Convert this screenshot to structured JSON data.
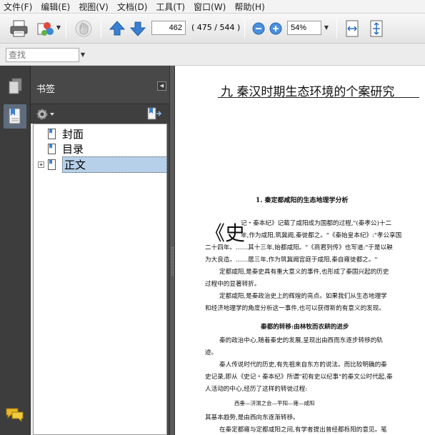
{
  "menu": [
    "文件(F)",
    "编辑(E)",
    "视图(V)",
    "文档(D)",
    "工具(T)",
    "窗口(W)",
    "帮助(H)"
  ],
  "toolbar": {
    "page_current": "462",
    "page_info": "( 475 / 544 )",
    "zoom": "54%"
  },
  "find": {
    "placeholder": "查找"
  },
  "bookmarks": {
    "title": "书签",
    "items": [
      "封面",
      "目录",
      "正文"
    ],
    "expander": "+"
  },
  "document": {
    "chapter_title": "九 秦汉时期生态环境的个案研究",
    "section_heading": "1. 秦定都咸阳的生态地理学分析",
    "dropcap": "《史",
    "lines": [
      "记・秦本纪》记载了咸阳成为国都的过程,\"(秦孝公)十二",
      "年,作为咸阳,筑冀阙,秦徙都之。\"《秦始皇本纪》:\"孝公享国",
      "二十四年。……其十三年,始都咸阳。\"《商君列传》也写道:\"于是以鞅",
      "为大良造。……居三年,作为筑冀阙宫庭于咸阳,秦自雍徙都之。\"",
      "定都咸阳,是秦史具有重大意义的事件,也形成了秦国兴起的历史",
      "过程中的显著转折。",
      "定都咸阳,是秦政治史上的辉煌的亮点。如果我们从生态地理学",
      "和经济地理学的角度分析这一事件,也可以获得新的有意义的发现。"
    ],
    "subheading": "秦都的转移:由林牧而农耕的进步",
    "lines2": [
      "秦的政治中心,随着秦史的发展,呈现出由西而东逐步转移的轨",
      "迹。",
      "秦人传说时代的历史,有先祖来自东方的说法。而比较明确的秦",
      "史记录,即从《史记・秦本纪》所谓\"初有史以纪事\"的秦文公时代起,秦",
      "人活动的中心,经历了这样的转徙过程:"
    ],
    "route": "西垂—汧渭之会—平阳—雍—咸阳",
    "lines3": [
      "其基本趋势,是由西向东逐渐转移。",
      "在秦定都雍与定都咸阳之间,有学者提出曾经都栎阳的意见。笔"
    ]
  },
  "colors": {
    "panel_dark": "#3d3d3d",
    "selection": "#b6d0ea",
    "toolbar_blue": "#3a7fd0"
  },
  "icons": [
    "printer-icon",
    "share-icon",
    "hand-icon",
    "prev-page-icon",
    "next-page-icon",
    "zoom-out-icon",
    "zoom-in-icon",
    "fit-width-icon",
    "fit-page-icon",
    "pages-icon",
    "bookmarks-icon",
    "gear-icon",
    "bookmark-expand-icon",
    "comment-icon"
  ]
}
